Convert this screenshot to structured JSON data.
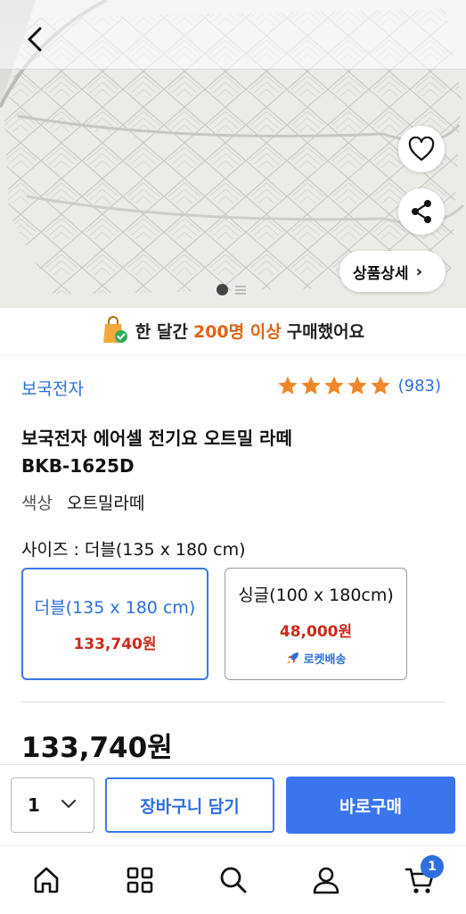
{
  "header": {
    "detail_label": "상품상세",
    "detail_chevron": "›",
    "image_dots": 2,
    "active_dot": 1
  },
  "social_proof": {
    "prefix": "한 달간",
    "highlight": "200명 이상",
    "suffix": "구매했어요"
  },
  "product": {
    "brand": "보국전자",
    "rating_stars": 5,
    "review_count": "(983)",
    "title_line1": "보국전자 에어셀 전기요 오트밀 라떼",
    "title_line2": "BKB-1625D",
    "color_label": "색상",
    "color_value": "오트밀라떼",
    "size_label": "사이즈 : 더블(135 x 180 cm)"
  },
  "options": [
    {
      "name": "더블(135 x 180 cm)",
      "price": "133,740원",
      "selected": true
    },
    {
      "name": "싱글(100 x 180cm)",
      "price": "48,000원",
      "badge": "로켓배송",
      "selected": false
    }
  ],
  "price": {
    "current": "133,740원"
  },
  "buy_bar": {
    "quantity": "1",
    "cart_label": "장바구니 담기",
    "buy_label": "바로구매"
  },
  "nav": {
    "items": [
      "home-icon",
      "category-grid-icon",
      "search-icon",
      "user-icon",
      "cart-icon"
    ],
    "cart_badge": "1"
  },
  "colors": {
    "accent_blue": "#2d6fde",
    "buy_button": "#3a75ee",
    "price_red": "#cc2a1c",
    "highlight_orange": "#e0641b",
    "star_orange": "#f0882a"
  }
}
